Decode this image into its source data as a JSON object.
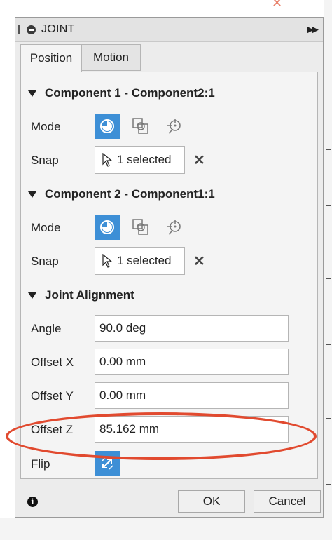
{
  "dialog": {
    "title": "JOINT",
    "tabs": [
      {
        "label": "Position",
        "active": true
      },
      {
        "label": "Motion",
        "active": false
      }
    ]
  },
  "component1": {
    "header": "Component 1 - Component2:1",
    "mode_label": "Mode",
    "snap_label": "Snap",
    "snap_value": "1 selected"
  },
  "component2": {
    "header": "Component 2 - Component1:1",
    "mode_label": "Mode",
    "snap_label": "Snap",
    "snap_value": "1 selected"
  },
  "alignment": {
    "header": "Joint Alignment",
    "angle_label": "Angle",
    "angle_value": "90.0 deg",
    "offset_x_label": "Offset X",
    "offset_x_value": "0.00 mm",
    "offset_y_label": "Offset Y",
    "offset_y_value": "0.00 mm",
    "offset_z_label": "Offset Z",
    "offset_z_value": "85.162 mm",
    "flip_label": "Flip"
  },
  "footer": {
    "ok_label": "OK",
    "cancel_label": "Cancel"
  },
  "colors": {
    "accent": "#3d8fd6",
    "annotation": "#e14a2f"
  },
  "icons": {
    "expand": "double-chevron-right-icon",
    "mode_simple": "target-simple-icon",
    "mode_between": "between-two-faces-icon",
    "mode_center": "center-point-icon",
    "snap": "cursor-arrow-icon",
    "clear": "close-icon",
    "flip": "flip-arrows-icon",
    "info": "info-icon"
  }
}
